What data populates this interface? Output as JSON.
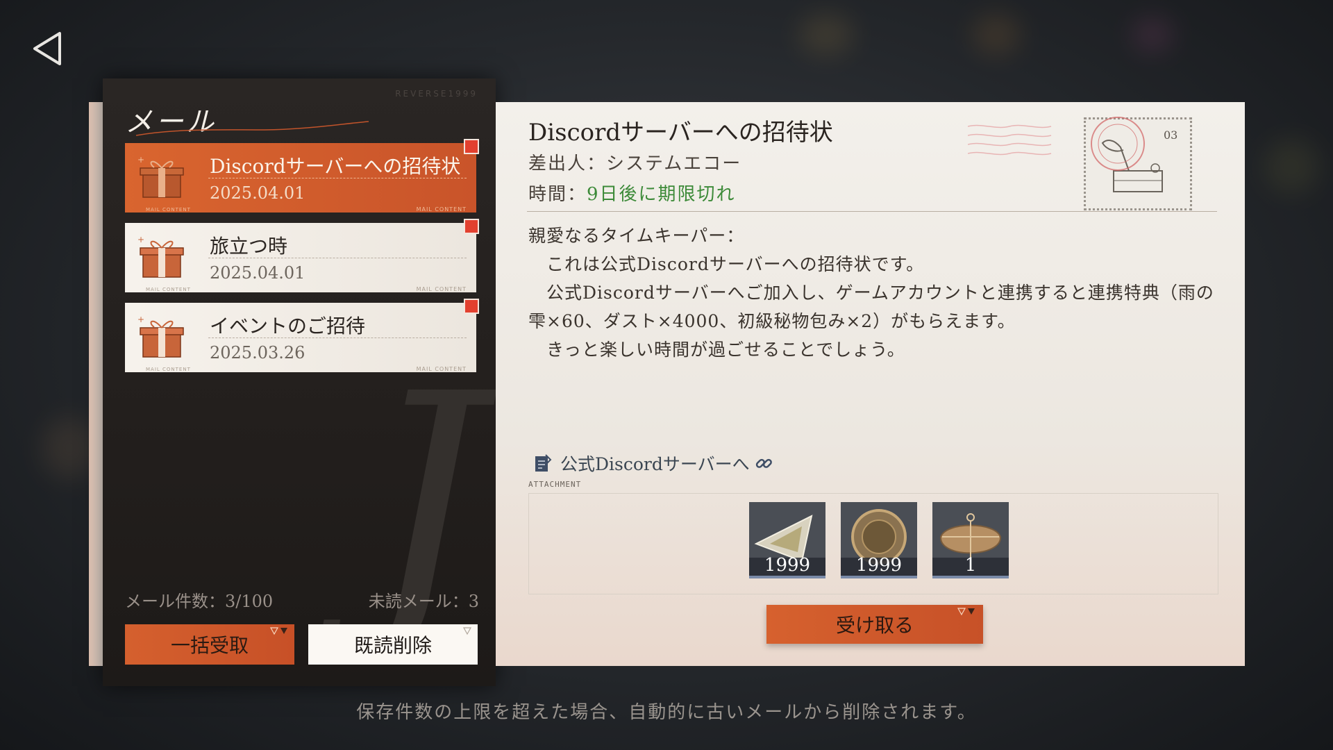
{
  "left_panel": {
    "title": "メール",
    "brand": "REVERSE1999",
    "mails": [
      {
        "subject": "Discordサーバーへの招待状",
        "date": "2025.04.01",
        "active": true
      },
      {
        "subject": "旅立つ時",
        "date": "2025.04.01",
        "active": false
      },
      {
        "subject": "イベントのご招待",
        "date": "2025.03.26",
        "active": false
      }
    ],
    "mail_tag": "MAIL CONTENT",
    "mail_count": "メール件数：3/100",
    "unread_count": "未読メール：3",
    "receive_all_label": "一括受取",
    "delete_read_label": "既読削除"
  },
  "detail": {
    "title": "Discordサーバーへの招待状",
    "sender": "差出人：システムエコー",
    "time_prefix": "時間：",
    "time_value": "9日後に期限切れ",
    "stamp_number": "03",
    "body": [
      "親愛なるタイムキーパー：",
      "　これは公式Discordサーバーへの招待状です。",
      "　公式Discordサーバーへご加入し、ゲームアカウントと連携すると連携特典（雨の雫×60、ダスト×4000、初級秘物包み×2）がもらえます。",
      "　きっと楽しい時間が過ごせることでしょう。"
    ],
    "link_text": "公式Discordサーバーへ",
    "attachment_label": "ATTACHMENT",
    "items": [
      {
        "icon": "crystal-icon",
        "count": "1999"
      },
      {
        "icon": "coin-icon",
        "count": "1999"
      },
      {
        "icon": "parcel-icon",
        "count": "1"
      }
    ],
    "receive_label": "受け取る"
  },
  "footer_note": "保存件数の上限を超えた場合、自動的に古いメールから削除されます。",
  "colors": {
    "accent": "#d5602e",
    "panel_dark": "#231f1d",
    "expiry_green": "#3c8a38",
    "unread_dot": "#e2402f"
  }
}
